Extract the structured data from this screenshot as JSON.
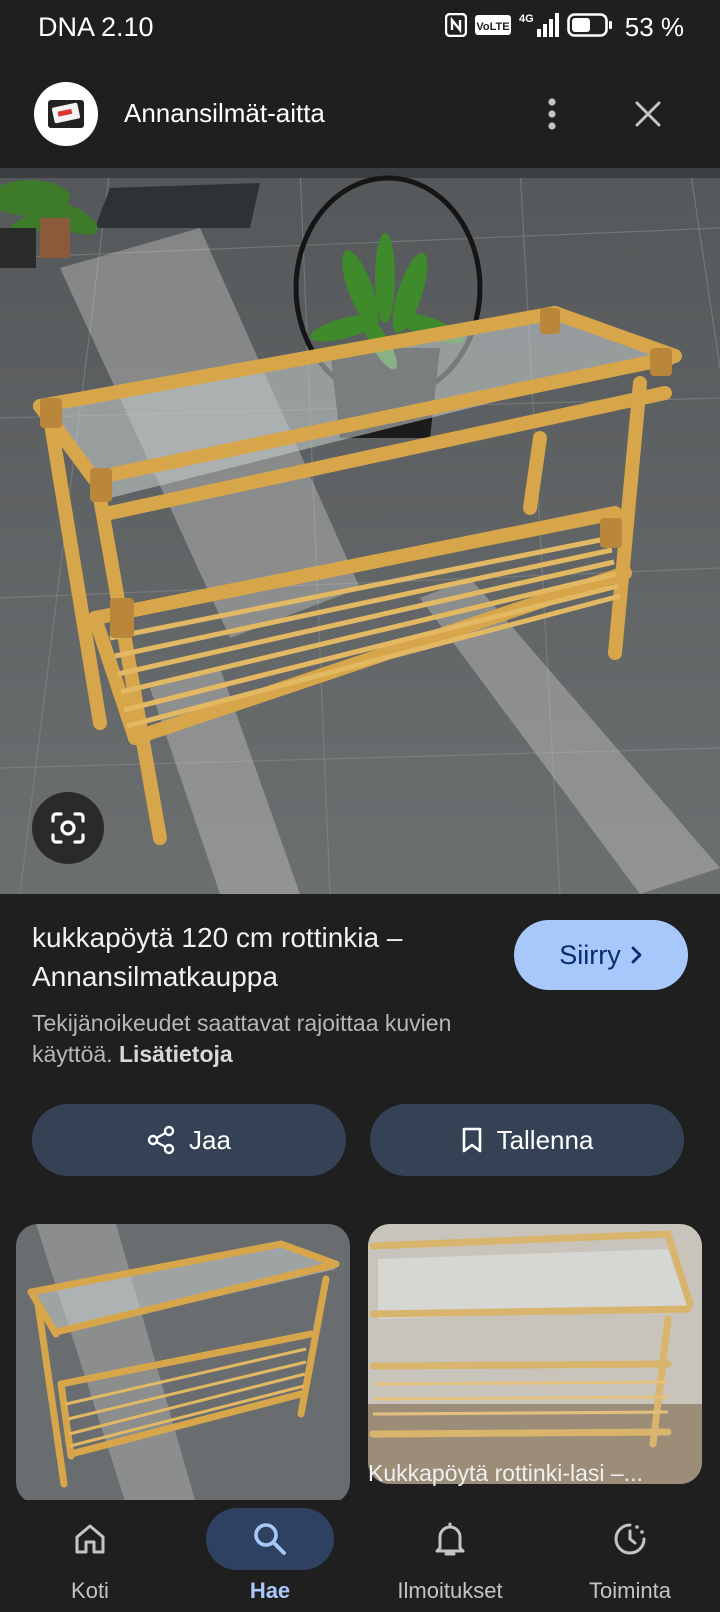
{
  "status_bar": {
    "time": "DNA 2.10",
    "volte": "VoLTE",
    "network": "4G",
    "battery": "53 %"
  },
  "app_bar": {
    "site_name": "Annansilmät-aitta"
  },
  "result": {
    "title": "kukkapöytä 120 cm rottinkia – Annansilmatkauppa",
    "visit_label": "Siirry",
    "copyright_text": "Tekijänoikeudet saattavat rajoittaa kuvien käyttöä.",
    "more_info": "Lisätietoja",
    "share_label": "Jaa",
    "save_label": "Tallenna"
  },
  "related": {
    "items": [
      {
        "caption": ""
      },
      {
        "caption": "Kukkapöytä rottinki-lasi –..."
      }
    ]
  },
  "bottom_nav": {
    "items": [
      {
        "label": "Koti",
        "icon": "home-icon"
      },
      {
        "label": "Hae",
        "icon": "search-icon",
        "active": true
      },
      {
        "label": "Ilmoitukset",
        "icon": "bell-icon"
      },
      {
        "label": "Toiminta",
        "icon": "history-icon"
      }
    ]
  },
  "colors": {
    "background": "#1f1f1f",
    "accent": "#a8c7fa",
    "chip": "#354256"
  }
}
